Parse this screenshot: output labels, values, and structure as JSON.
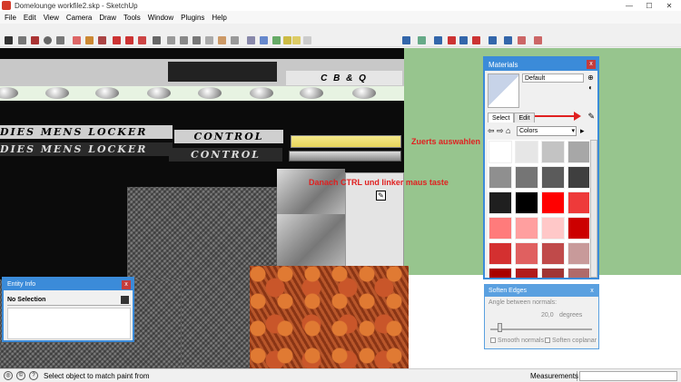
{
  "window": {
    "title": "Domelounge workfile2.skp - SketchUp",
    "controls": [
      "—",
      "☐",
      "✕"
    ]
  },
  "menu": [
    "File",
    "Edit",
    "View",
    "Camera",
    "Draw",
    "Tools",
    "Window",
    "Plugins",
    "Help"
  ],
  "scene": {
    "sign_top": "C B & Q",
    "sign_light_1": "DIES  MENS  LOCKER",
    "sign_control_1": "CONTROL",
    "sign_dark_1": "DIES  MENS  LOCKER",
    "sign_control_2": "CONTROL",
    "annotation_1": "Zuerts auswahlen",
    "annotation_2": "Danach CTRL und linker maus taste"
  },
  "materials": {
    "title": "Materials",
    "close_label": "x",
    "material_name": "Default",
    "tab_select": "Select",
    "tab_edit": "Edit",
    "library": "Colors",
    "swatches": [
      "#ffffff",
      "#e6e6e6",
      "#c3c3c3",
      "#a7a7a7",
      "#8f8f8f",
      "#757575",
      "#5b5b5b",
      "#3f3f3f",
      "#1f1f1f",
      "#000000",
      "#ff0000",
      "#ee3a3a",
      "#ff7b7b",
      "#ff9f9f",
      "#ffc8c8",
      "#cc0000",
      "#d43030",
      "#e06060",
      "#c04a4a",
      "#c89a9a",
      "#a80000",
      "#b21c1c",
      "#a03535",
      "#b06a6a"
    ]
  },
  "soften": {
    "title": "Soften Edges",
    "close_label": "x",
    "angle_label": "Angle between normals:",
    "angle_value": "20,0",
    "angle_unit": "degrees",
    "smooth_label": "Smooth normals",
    "coplanar_label": "Soften coplanar"
  },
  "entity": {
    "title": "Entity Info",
    "close_label": "x",
    "selection": "No Selection"
  },
  "status": {
    "message": "Select object to match paint from",
    "measurements_label": "Measurements",
    "measurements_value": ""
  }
}
